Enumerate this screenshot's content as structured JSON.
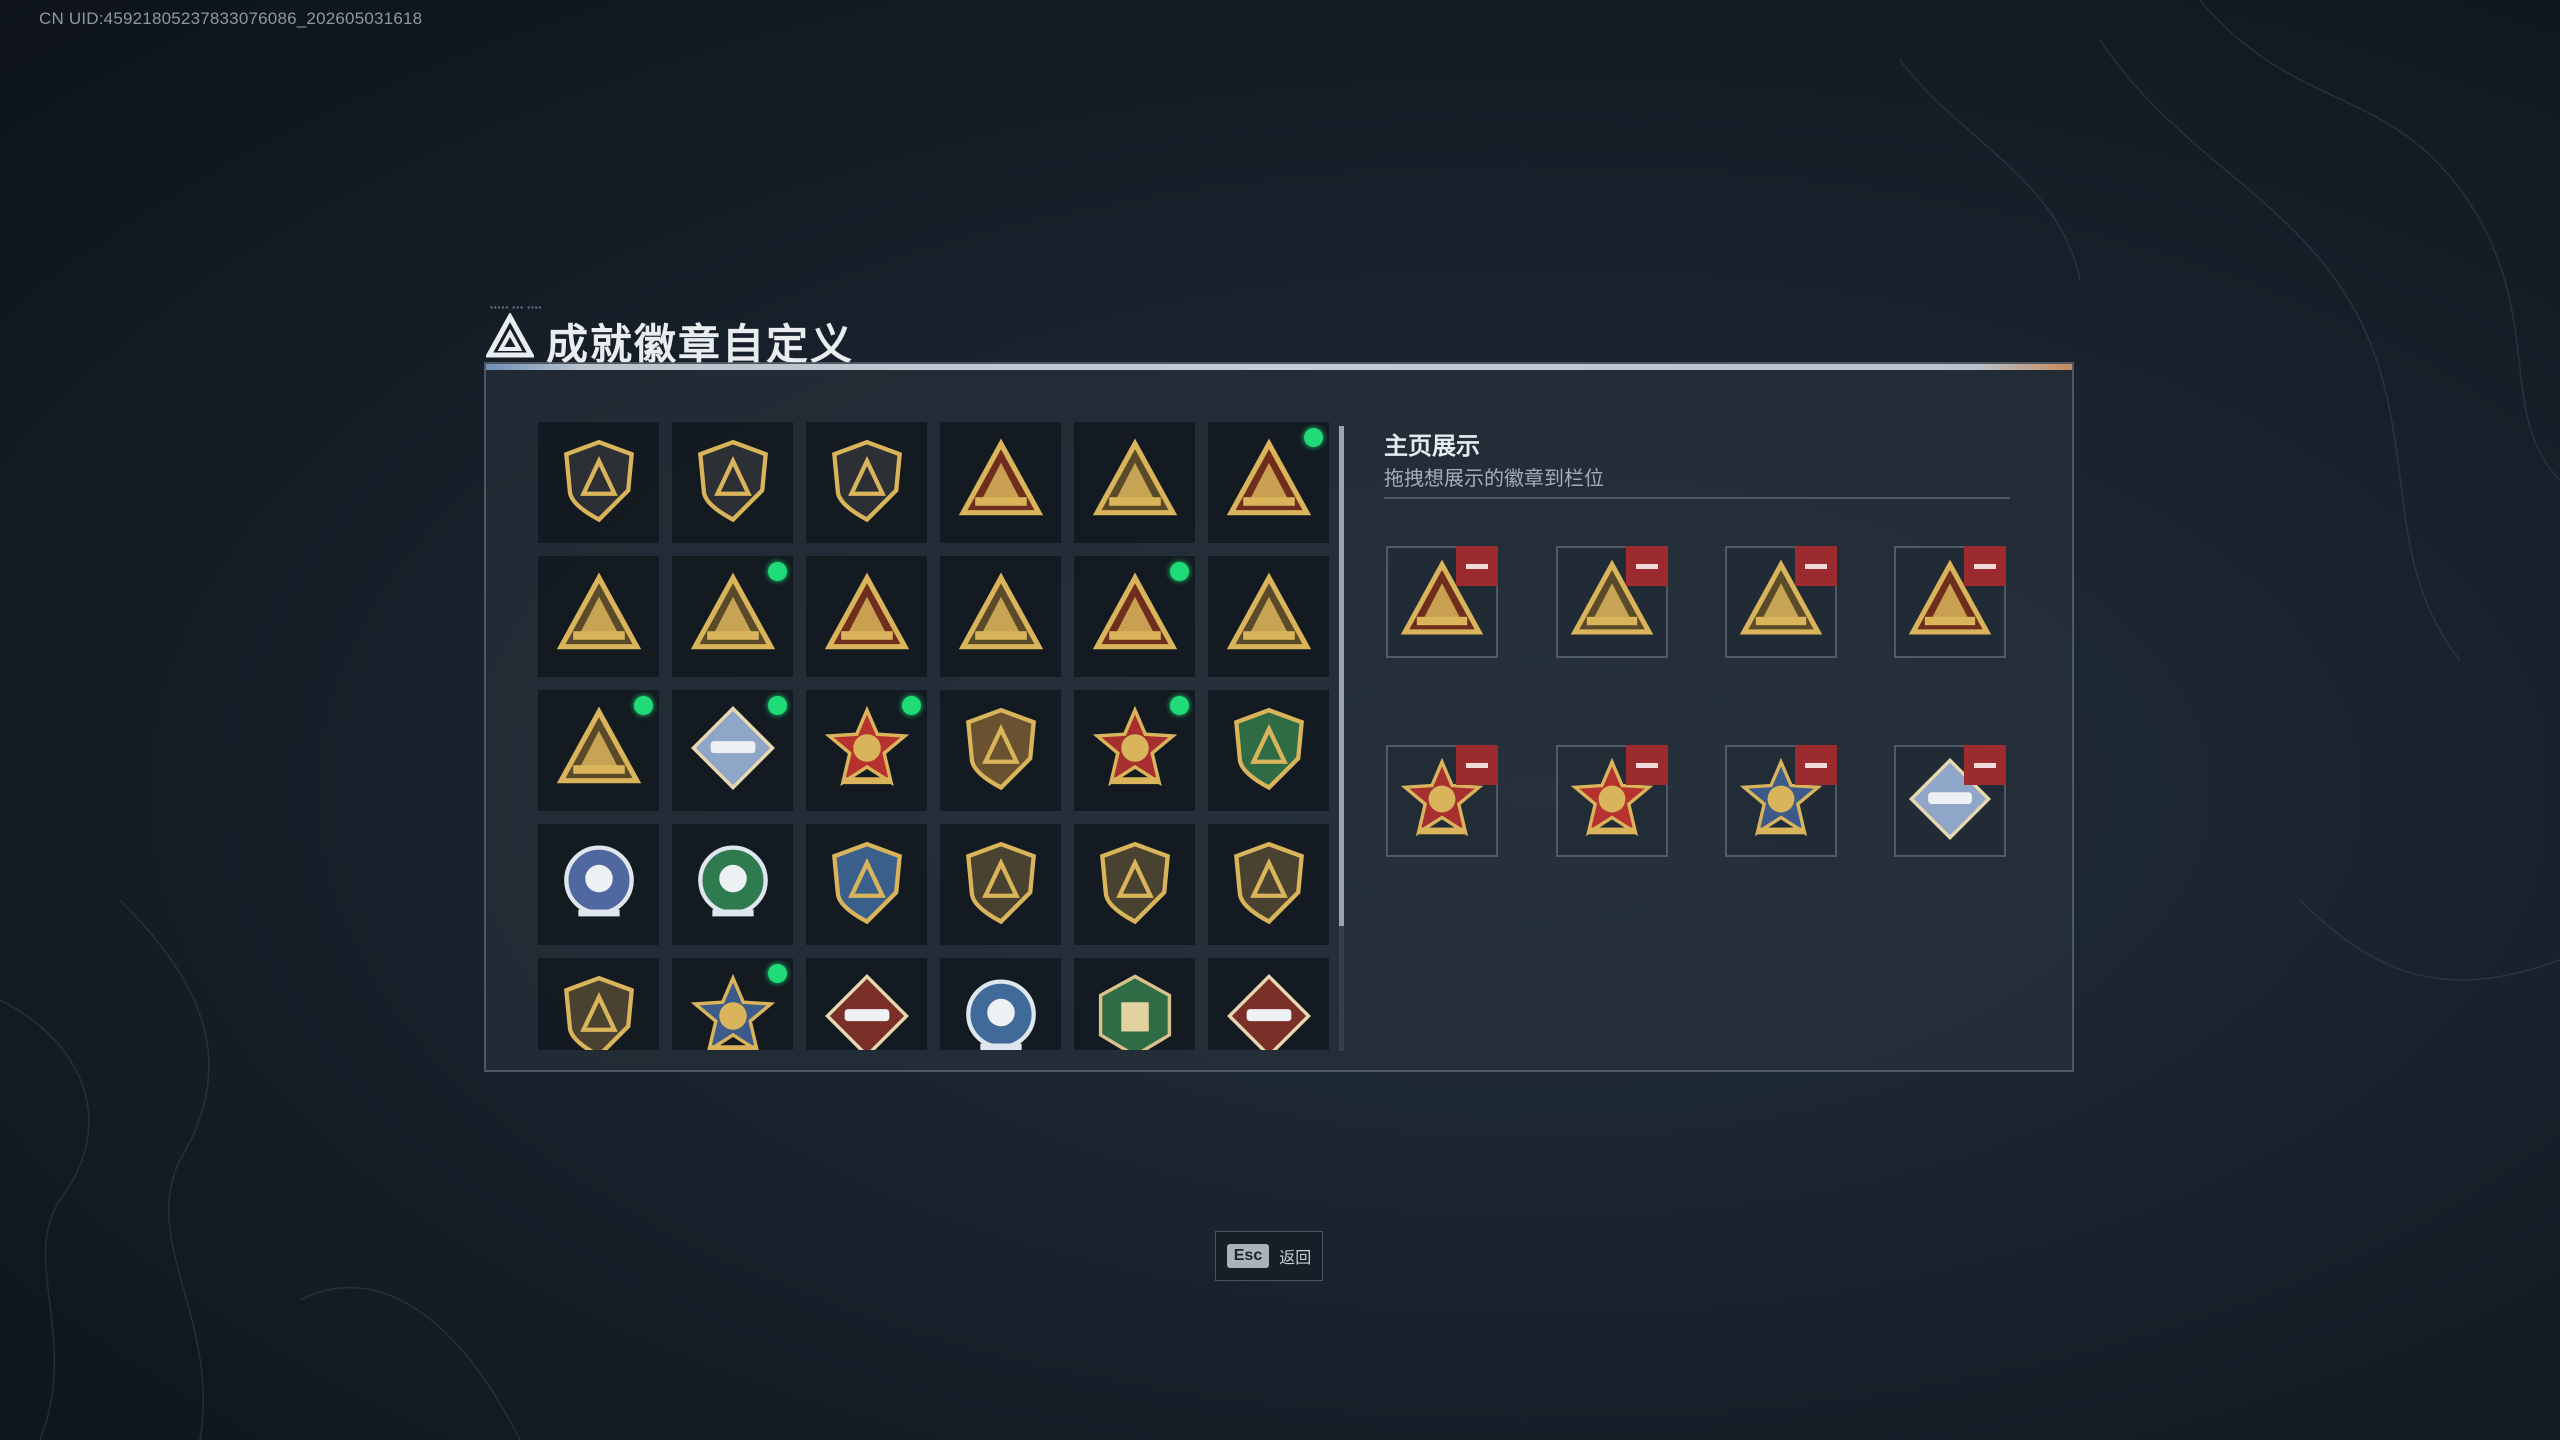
{
  "uid": "CN UID:4592180523783307608​6_202605031618",
  "header": {
    "title": "成就徽章自定义",
    "logo_icon": "triangle-logo-icon"
  },
  "left_grid": {
    "badges": [
      {
        "icon": "shield-triangle-badge",
        "frame": "shield",
        "color": "#2c3035",
        "new": false
      },
      {
        "icon": "helicopter-badge",
        "frame": "shield",
        "color": "#2c3035",
        "new": false
      },
      {
        "icon": "sword-shield-badge",
        "frame": "shield",
        "color": "#2c3035",
        "new": false
      },
      {
        "icon": "eye-triangle-badge",
        "frame": "triangle",
        "color": "#6e2d1d",
        "new": false
      },
      {
        "icon": "bag-55-triangle-badge",
        "frame": "triangle",
        "color": "#5a4a2a",
        "new": false
      },
      {
        "icon": "tank-triangle-badge",
        "frame": "triangle",
        "color": "#6e2d1d",
        "new": true
      },
      {
        "icon": "helmet-triangle-badge",
        "frame": "triangle",
        "color": "#5a4a2a",
        "new": false
      },
      {
        "icon": "gunner-triangle-badge",
        "frame": "triangle",
        "color": "#5a4a2a",
        "new": true
      },
      {
        "icon": "number-one-triangle-badge",
        "frame": "triangle",
        "color": "#6e2d1d",
        "new": false
      },
      {
        "icon": "soldier-triangle-badge",
        "frame": "triangle",
        "color": "#5a4a2a",
        "new": false
      },
      {
        "icon": "medic-triangle-badge",
        "frame": "triangle",
        "color": "#6e2d1d",
        "new": true
      },
      {
        "icon": "squad-triangle-badge",
        "frame": "triangle",
        "color": "#5a4a2a",
        "new": false
      },
      {
        "icon": "rocket-triangle-badge",
        "frame": "triangle",
        "color": "#5a4a2a",
        "new": true
      },
      {
        "icon": "launcher-diamond-badge",
        "frame": "diamond",
        "color": "#8fa6c8",
        "new": true
      },
      {
        "icon": "star-medal-badge",
        "frame": "medal",
        "color": "#b5322e",
        "new": true
      },
      {
        "icon": "bronze-shield-badge",
        "frame": "shield",
        "color": "#6a5230",
        "new": false
      },
      {
        "icon": "crest-shield-badge",
        "frame": "medal",
        "color": "#a82f2f",
        "new": true
      },
      {
        "icon": "green-emblem-badge",
        "frame": "shield",
        "color": "#2f6b45",
        "new": false
      },
      {
        "icon": "skull-medal-badge",
        "frame": "round",
        "color": "#5068a0",
        "new": false
      },
      {
        "icon": "green-burst-badge",
        "frame": "round",
        "color": "#2f7a4e",
        "new": false
      },
      {
        "icon": "crosshair-shield-badge",
        "frame": "shield",
        "color": "#3a5f8a",
        "new": false
      },
      {
        "icon": "rifle-shield-badge",
        "frame": "shield",
        "color": "#4a4230",
        "new": false
      },
      {
        "icon": "sniper-shield-badge",
        "frame": "shield",
        "color": "#4a4230",
        "new": false
      },
      {
        "icon": "smg-shield-badge",
        "frame": "shield",
        "color": "#4a4230",
        "new": false
      },
      {
        "icon": "knife-shield-badge",
        "frame": "shield",
        "color": "#4a4230",
        "new": false
      },
      {
        "icon": "gold-crest-badge",
        "frame": "medal",
        "color": "#3c5a8a",
        "new": true
      },
      {
        "icon": "wolf-diamond-badge",
        "frame": "diamond",
        "color": "#7a2f28",
        "new": false
      },
      {
        "icon": "eagle-round-badge",
        "frame": "round",
        "color": "#3f6a9a",
        "new": false
      },
      {
        "icon": "hexagon-soldier-badge",
        "frame": "hex",
        "color": "#2f6b45",
        "new": false
      },
      {
        "icon": "dragon-diamond-badge",
        "frame": "diamond",
        "color": "#7a2f28",
        "new": false
      }
    ]
  },
  "showcase": {
    "title": "主页展示",
    "subtitle": "拖拽想展示的徽章到栏位",
    "slots": [
      {
        "icon": "medic-triangle-badge",
        "frame": "triangle",
        "color": "#6e2d1d",
        "remove_icon": "minus-icon"
      },
      {
        "icon": "rocket-triangle-badge",
        "frame": "triangle",
        "color": "#5a4a2a",
        "remove_icon": "minus-icon"
      },
      {
        "icon": "gunner-triangle-badge",
        "frame": "triangle",
        "color": "#5a4a2a",
        "remove_icon": "minus-icon"
      },
      {
        "icon": "tank-triangle-badge",
        "frame": "triangle",
        "color": "#6e2d1d",
        "remove_icon": "minus-icon"
      },
      {
        "icon": "crest-shield-badge",
        "frame": "medal",
        "color": "#a82f2f",
        "remove_icon": "minus-icon"
      },
      {
        "icon": "star-medal-badge",
        "frame": "medal",
        "color": "#b5322e",
        "remove_icon": "minus-icon"
      },
      {
        "icon": "gold-crest-badge",
        "frame": "medal",
        "color": "#3c5a8a",
        "remove_icon": "minus-icon"
      },
      {
        "icon": "launcher-diamond-badge",
        "frame": "diamond",
        "color": "#8fa6c8",
        "remove_icon": "minus-icon"
      }
    ]
  },
  "footer": {
    "key": "Esc",
    "label": "返回"
  },
  "colors": {
    "accent_new": "#1fdc77",
    "remove_red": "#9c2b2f",
    "gold": "#d9b45a"
  }
}
